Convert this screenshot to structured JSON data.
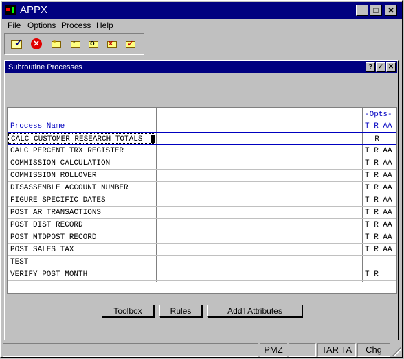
{
  "window": {
    "title": "APPX",
    "minimize": "_",
    "maximize": "□",
    "close": "✕"
  },
  "menu": [
    "File",
    "Options",
    "Process",
    "Help"
  ],
  "toolbar": {
    "icons": [
      "ok-icon",
      "cancel-icon",
      "new-folder-icon",
      "open-folder-icon",
      "search-folder-icon",
      "delete-folder-icon",
      "edit-folder-icon"
    ]
  },
  "panel": {
    "title": "Subroutine Processes",
    "help": "?",
    "check": "✓",
    "close": "✕"
  },
  "table": {
    "header_name": "Process Name",
    "header_opts": "-Opts-",
    "header_opt_labels": "T R AA",
    "rows": [
      {
        "name": "CALC CUSTOMER RESEARCH TOTALS",
        "opts": "  R"
      },
      {
        "name": "CALC PERCENT TRX REGISTER",
        "opts": "T R AA"
      },
      {
        "name": "COMMISSION CALCULATION",
        "opts": "T R AA"
      },
      {
        "name": "COMMISSION ROLLOVER",
        "opts": "T R AA"
      },
      {
        "name": "DISASSEMBLE ACCOUNT NUMBER",
        "opts": "T R AA"
      },
      {
        "name": "FIGURE SPECIFIC DATES",
        "opts": "T R AA"
      },
      {
        "name": "POST AR TRANSACTIONS",
        "opts": "T R AA"
      },
      {
        "name": "POST DIST RECORD",
        "opts": "T R AA"
      },
      {
        "name": "POST MTDPOST RECORD",
        "opts": "T R AA"
      },
      {
        "name": "POST SALES TAX",
        "opts": "T R AA"
      },
      {
        "name": "TEST",
        "opts": ""
      },
      {
        "name": "VERIFY POST MONTH",
        "opts": "T R"
      }
    ]
  },
  "buttons": {
    "toolbox": "Toolbox",
    "rules": "Rules",
    "addl": "Add'l Attributes"
  },
  "status": {
    "seg1": "",
    "seg2": "PMZ",
    "seg3": "",
    "seg4": "TAR TA",
    "seg5": "Chg"
  }
}
